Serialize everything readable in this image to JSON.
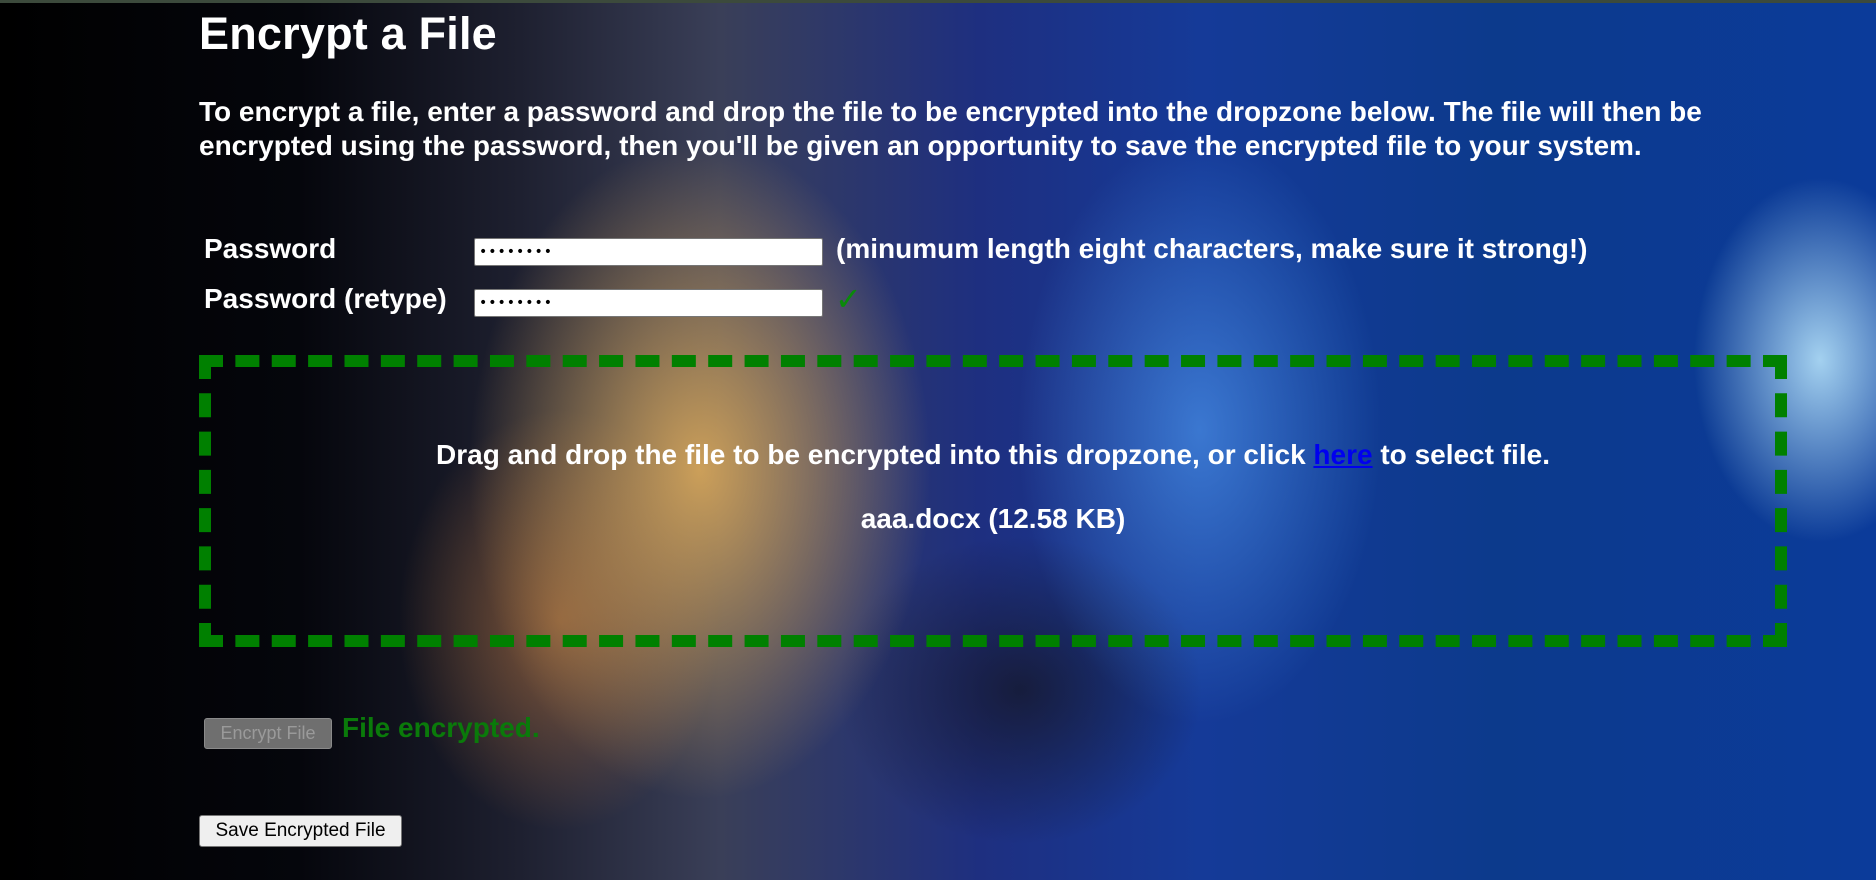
{
  "page": {
    "title": "Encrypt a File",
    "intro": "To encrypt a file, enter a password and drop the file to be encrypted into the dropzone below. The file will then be encrypted using the password, then you'll be given an opportunity to save the encrypted file to your system."
  },
  "form": {
    "password_label": "Password",
    "password_value": "••••••••",
    "password_hint": "(minumum length eight characters, make sure it strong!)",
    "retype_label": "Password (retype)",
    "retype_value": "••••••••",
    "match_icon": "✓"
  },
  "dropzone": {
    "text_before": "Drag and drop the file to be encrypted into this dropzone, or click ",
    "link_text": "here",
    "text_after": " to select file.",
    "file_info": "aaa.docx (12.58 KB)",
    "border_color": "#008000"
  },
  "actions": {
    "encrypt_label": "Encrypt File",
    "status_text": "File encrypted.",
    "save_label": "Save Encrypted File",
    "status_color": "#0a7a0a"
  }
}
